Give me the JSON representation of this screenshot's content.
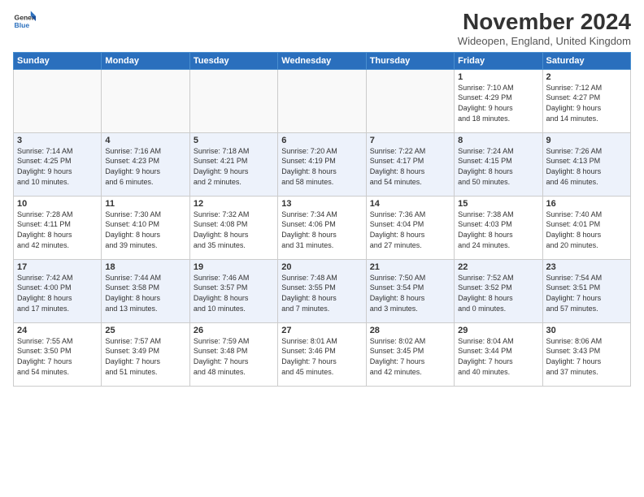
{
  "header": {
    "logo_line1": "General",
    "logo_line2": "Blue",
    "month_title": "November 2024",
    "location": "Wideopen, England, United Kingdom"
  },
  "weekdays": [
    "Sunday",
    "Monday",
    "Tuesday",
    "Wednesday",
    "Thursday",
    "Friday",
    "Saturday"
  ],
  "weeks": [
    [
      {
        "day": "",
        "info": ""
      },
      {
        "day": "",
        "info": ""
      },
      {
        "day": "",
        "info": ""
      },
      {
        "day": "",
        "info": ""
      },
      {
        "day": "",
        "info": ""
      },
      {
        "day": "1",
        "info": "Sunrise: 7:10 AM\nSunset: 4:29 PM\nDaylight: 9 hours\nand 18 minutes."
      },
      {
        "day": "2",
        "info": "Sunrise: 7:12 AM\nSunset: 4:27 PM\nDaylight: 9 hours\nand 14 minutes."
      }
    ],
    [
      {
        "day": "3",
        "info": "Sunrise: 7:14 AM\nSunset: 4:25 PM\nDaylight: 9 hours\nand 10 minutes."
      },
      {
        "day": "4",
        "info": "Sunrise: 7:16 AM\nSunset: 4:23 PM\nDaylight: 9 hours\nand 6 minutes."
      },
      {
        "day": "5",
        "info": "Sunrise: 7:18 AM\nSunset: 4:21 PM\nDaylight: 9 hours\nand 2 minutes."
      },
      {
        "day": "6",
        "info": "Sunrise: 7:20 AM\nSunset: 4:19 PM\nDaylight: 8 hours\nand 58 minutes."
      },
      {
        "day": "7",
        "info": "Sunrise: 7:22 AM\nSunset: 4:17 PM\nDaylight: 8 hours\nand 54 minutes."
      },
      {
        "day": "8",
        "info": "Sunrise: 7:24 AM\nSunset: 4:15 PM\nDaylight: 8 hours\nand 50 minutes."
      },
      {
        "day": "9",
        "info": "Sunrise: 7:26 AM\nSunset: 4:13 PM\nDaylight: 8 hours\nand 46 minutes."
      }
    ],
    [
      {
        "day": "10",
        "info": "Sunrise: 7:28 AM\nSunset: 4:11 PM\nDaylight: 8 hours\nand 42 minutes."
      },
      {
        "day": "11",
        "info": "Sunrise: 7:30 AM\nSunset: 4:10 PM\nDaylight: 8 hours\nand 39 minutes."
      },
      {
        "day": "12",
        "info": "Sunrise: 7:32 AM\nSunset: 4:08 PM\nDaylight: 8 hours\nand 35 minutes."
      },
      {
        "day": "13",
        "info": "Sunrise: 7:34 AM\nSunset: 4:06 PM\nDaylight: 8 hours\nand 31 minutes."
      },
      {
        "day": "14",
        "info": "Sunrise: 7:36 AM\nSunset: 4:04 PM\nDaylight: 8 hours\nand 27 minutes."
      },
      {
        "day": "15",
        "info": "Sunrise: 7:38 AM\nSunset: 4:03 PM\nDaylight: 8 hours\nand 24 minutes."
      },
      {
        "day": "16",
        "info": "Sunrise: 7:40 AM\nSunset: 4:01 PM\nDaylight: 8 hours\nand 20 minutes."
      }
    ],
    [
      {
        "day": "17",
        "info": "Sunrise: 7:42 AM\nSunset: 4:00 PM\nDaylight: 8 hours\nand 17 minutes."
      },
      {
        "day": "18",
        "info": "Sunrise: 7:44 AM\nSunset: 3:58 PM\nDaylight: 8 hours\nand 13 minutes."
      },
      {
        "day": "19",
        "info": "Sunrise: 7:46 AM\nSunset: 3:57 PM\nDaylight: 8 hours\nand 10 minutes."
      },
      {
        "day": "20",
        "info": "Sunrise: 7:48 AM\nSunset: 3:55 PM\nDaylight: 8 hours\nand 7 minutes."
      },
      {
        "day": "21",
        "info": "Sunrise: 7:50 AM\nSunset: 3:54 PM\nDaylight: 8 hours\nand 3 minutes."
      },
      {
        "day": "22",
        "info": "Sunrise: 7:52 AM\nSunset: 3:52 PM\nDaylight: 8 hours\nand 0 minutes."
      },
      {
        "day": "23",
        "info": "Sunrise: 7:54 AM\nSunset: 3:51 PM\nDaylight: 7 hours\nand 57 minutes."
      }
    ],
    [
      {
        "day": "24",
        "info": "Sunrise: 7:55 AM\nSunset: 3:50 PM\nDaylight: 7 hours\nand 54 minutes."
      },
      {
        "day": "25",
        "info": "Sunrise: 7:57 AM\nSunset: 3:49 PM\nDaylight: 7 hours\nand 51 minutes."
      },
      {
        "day": "26",
        "info": "Sunrise: 7:59 AM\nSunset: 3:48 PM\nDaylight: 7 hours\nand 48 minutes."
      },
      {
        "day": "27",
        "info": "Sunrise: 8:01 AM\nSunset: 3:46 PM\nDaylight: 7 hours\nand 45 minutes."
      },
      {
        "day": "28",
        "info": "Sunrise: 8:02 AM\nSunset: 3:45 PM\nDaylight: 7 hours\nand 42 minutes."
      },
      {
        "day": "29",
        "info": "Sunrise: 8:04 AM\nSunset: 3:44 PM\nDaylight: 7 hours\nand 40 minutes."
      },
      {
        "day": "30",
        "info": "Sunrise: 8:06 AM\nSunset: 3:43 PM\nDaylight: 7 hours\nand 37 minutes."
      }
    ]
  ]
}
